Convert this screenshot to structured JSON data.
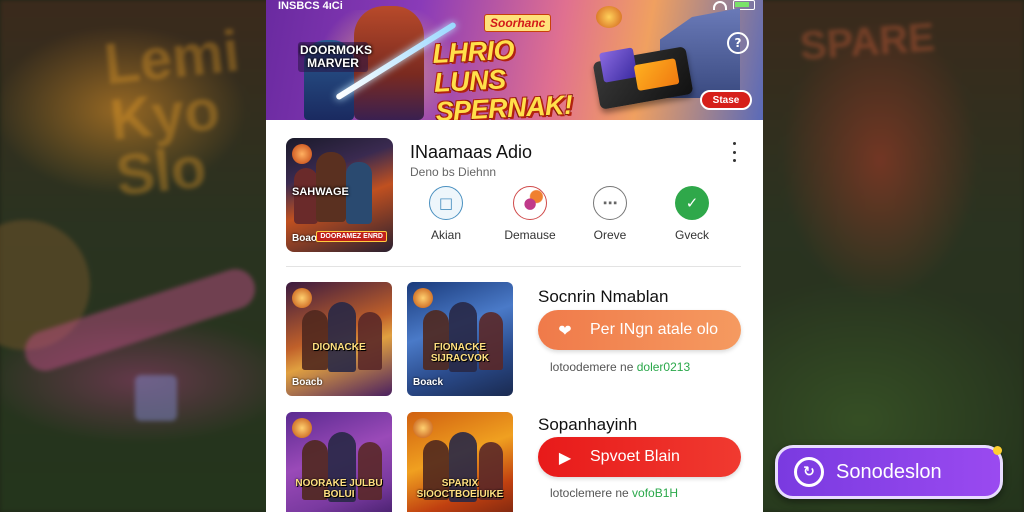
{
  "background": {
    "word_left": "Lemi\nKyo\nSlo",
    "word_right": "SPARE"
  },
  "banner": {
    "status_left": "INSBCS 4ıCi",
    "logo_text": "DOORMOKS MARVER",
    "badge": "Soorhanc",
    "headline": "LHRIO LUNS SPERNAK!",
    "cta": "Stase",
    "help_icon": "help-circle-icon"
  },
  "app": {
    "thumb_title": "SAHWAGE",
    "thumb_caption": "Boaoo",
    "thumb_tag": "DOORAMEZ ENRD",
    "name": "INaamaas Adio",
    "subtitle": "Deno bs Diehnn",
    "actions": [
      {
        "label": "Akian",
        "icon": "about-icon"
      },
      {
        "label": "Demause",
        "icon": "details-icon"
      },
      {
        "label": "Oreve",
        "icon": "review-icon"
      },
      {
        "label": "Gveck",
        "icon": "check-icon"
      }
    ]
  },
  "tiles": [
    {
      "title": "DIONACKE",
      "caption": "Boacb"
    },
    {
      "title": "FIONACKE SIJRACVOK",
      "caption": "Boack"
    },
    {
      "title": "NOORAKE JULBU BOLUI",
      "caption": ""
    },
    {
      "title": "SPARIX SIOOCTBOEIUIKE",
      "caption": ""
    }
  ],
  "sections": [
    {
      "title": "Socnrin Nmablan",
      "button_label": "Per INgn atale olo",
      "button_icon": "heart-icon",
      "meta_prefix": "lotoodemere ne ",
      "meta_accent": "doler0213"
    },
    {
      "title": "Sopanhayinh",
      "button_label": "Spvoet Blain",
      "button_icon": "play-icon",
      "meta_prefix": "lotoclemere ne ",
      "meta_accent": "vofoB1H"
    }
  ],
  "floating_button": {
    "label": "Sonodeslon",
    "icon": "swirl-icon"
  },
  "colors": {
    "orange_button": "#f07a4a",
    "red_button": "#e81a1a",
    "purple_button": "#8a42e8",
    "accent_green": "#2aa84a"
  }
}
